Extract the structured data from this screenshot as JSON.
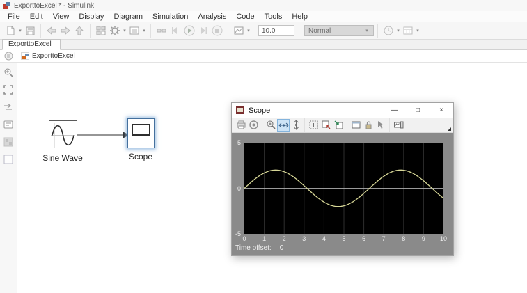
{
  "app": {
    "title": "ExporttoExcel * - Simulink"
  },
  "menu": {
    "items": [
      "File",
      "Edit",
      "View",
      "Display",
      "Diagram",
      "Simulation",
      "Analysis",
      "Code",
      "Tools",
      "Help"
    ]
  },
  "toolbar": {
    "stop_time": "10.0",
    "sim_mode": "Normal",
    "icon_names": [
      "new-model",
      "save",
      "navigate-back",
      "navigate-forward",
      "navigate-up",
      "library-browser",
      "model-configuration",
      "model-settings",
      "update-diagram",
      "step-back",
      "run",
      "step-forward",
      "stop",
      "simulation-data-inspector",
      "code-perspective",
      "schedule-editor"
    ]
  },
  "icons": {
    "caret": "▾",
    "minimize": "—",
    "maximize": "□",
    "close": "×"
  },
  "tab": {
    "label": "ExporttoExcel"
  },
  "breadcrumb": {
    "model": "ExporttoExcel"
  },
  "sidebar": {
    "icon_names": [
      "zoom",
      "fit-to-view",
      "signal-arrows",
      "legend",
      "model-browser",
      "blank-square"
    ]
  },
  "canvas": {
    "blocks": [
      {
        "label": "Sine Wave",
        "type": "source"
      },
      {
        "label": "Scope",
        "type": "sink",
        "selected": true
      }
    ]
  },
  "scope": {
    "title": "Scope",
    "toolbar_icons": [
      "print",
      "parameters",
      "zoom",
      "zoom-x-selected",
      "zoom-y",
      "autoscale",
      "save-axes-settings",
      "restore-axes-settings",
      "floating-scope",
      "lock-axes",
      "signal-selection",
      "scope-viewer"
    ],
    "time_offset_label": "Time offset:",
    "time_offset_value": "0"
  },
  "chart_data": {
    "type": "line",
    "title": "",
    "signal": "sine",
    "series": [
      {
        "name": "Sine Wave",
        "amplitude": 2,
        "angular_frequency": 1,
        "phase": 0
      }
    ],
    "amplitude": 2,
    "angular_frequency": 1,
    "phase": 0,
    "x_range": [
      0,
      10
    ],
    "y_range": [
      -5,
      5
    ],
    "xticks": [
      0,
      1,
      2,
      3,
      4,
      5,
      6,
      7,
      8,
      9,
      10
    ],
    "yticks": [
      5,
      0,
      -5
    ],
    "grid": true,
    "plot_bg": "#000000",
    "grid_color": "#2e2e2e",
    "zero_line_color": "#b5b5b5",
    "line_color": "#d6d696",
    "frame_color": "#8a8a8a"
  }
}
